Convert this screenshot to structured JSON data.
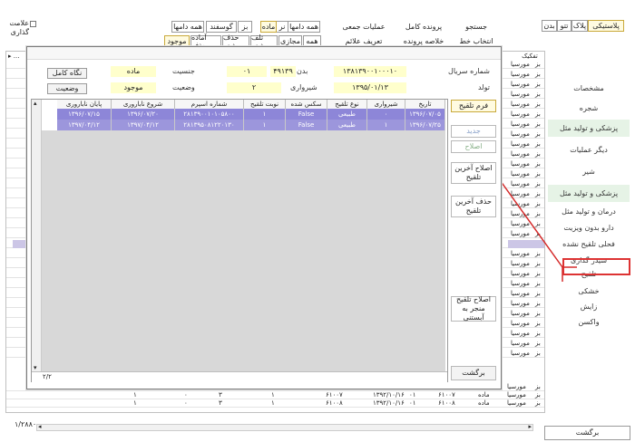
{
  "top_left": {
    "mark_label": "علامت گذاری",
    "status_count": "۱/۲۸۸۰"
  },
  "top_tabs_row1": {
    "all_herds": "همه دامها",
    "sheep": "گوسفند",
    "goat": "بز",
    "all_herds2": "همه دامها",
    "male": "نر",
    "female": "ماده",
    "group_ops": "عملیات جمعی",
    "full_file": "پرونده کامل",
    "search": "جستجو"
  },
  "top_tabs_row2": {
    "present": "موجود",
    "ready_for_slaughter": "آماده حذف",
    "removed": "حذف شده",
    "dead": "تلف شده",
    "virtual": "مجازی",
    "all": "همه",
    "mark_define": "تعریف علائم",
    "file_summary": "خلاصه پرونده",
    "line_select": "انتخاب خط"
  },
  "breed_tabs": {
    "plastic": "پلاستیکی",
    "pelak": "پلاک",
    "tattoo": "تتو",
    "badan": "بدن"
  },
  "bg_header_col": "تفکیک",
  "side_nav": [
    "مشخصات",
    "شجره",
    "پزشکی و تولید مثل",
    "دیگر عملیات",
    "شیر",
    "پزشکی و تولید مثل",
    "درمان و تولید مثل",
    "دارو بدون ویزیت",
    "فحلی تلقیح نشده",
    "سیدر گذاری",
    "تلقیح",
    "خشکی",
    "زایش",
    "واکسن"
  ],
  "bottom_back": "برگشت",
  "dialog": {
    "info": {
      "serial_label": "شماره سریال",
      "serial_value": "۱۳۸۱۳۹۰۰۱۰۰۰۱۰",
      "body_label": "بدن",
      "body_value": "۴۹۱۳۹",
      "herd_value": "۰۱",
      "sex_label": "جنسیت",
      "sex_value": "ماده",
      "birth_label": "تولد",
      "birth_value": "۱۳۹۵/۰۱/۱۳",
      "lactation_label": "شیرواری",
      "lactation_value": "۲",
      "status_label": "وضعیت",
      "status_value": "موجود",
      "full_view_btn": "نگاه کامل",
      "status_btn": "وضعیت"
    },
    "grid": {
      "columns": [
        "تاریخ",
        "شیرواری",
        "نوع تلقیح",
        "سکس شده",
        "نوبت تلقیح",
        "شماره اسپرم",
        "شروع ناباروری",
        "پایان ناباروری"
      ],
      "rows": [
        [
          "۱۳۹۶/۰۷/۰۵",
          "۰",
          "طبیعی",
          "False",
          "۱",
          "۲۸۱۳۹۰۰۱۰۱۰۵۸۰۰",
          "۱۳۹۶/۰۷/۲۰",
          "۱۳۹۶/۰۷/۱۵"
        ],
        [
          "۱۳۹۶/۰۷/۲۵",
          "۱",
          "طبیعی",
          "False",
          "۱",
          "۲۸۱۳۹۵۰۸۱۲۲۰۱۳۰",
          "۱۳۹۷/۰۴/۱۲",
          "۱۳۹۷/۰۴/۱۲"
        ]
      ],
      "footer": "۲/۲"
    },
    "side_buttons": {
      "insem_form": "فرم تلقیح",
      "new": "جدید",
      "edit": "اصلاح",
      "edit_last": "اصلاح آخرین تلقیح",
      "delete_last": "حذف آخرین تلقیح",
      "edit_abortion": "اصلاح تلقیح منجر به آبستنی",
      "back": "برگشت"
    }
  },
  "bg_rows": [
    {
      "herd": "بز",
      "type": "مورسیا"
    },
    {
      "herd": "بز",
      "type": "مورسیا"
    },
    {
      "herd": "بز",
      "type": "مورسیا"
    },
    {
      "herd": "بز",
      "type": "مورسیا"
    },
    {
      "herd": "بز",
      "type": "مورسیا"
    },
    {
      "herd": "بز",
      "type": "مورسیا"
    },
    {
      "herd": "بز",
      "type": "مورسیا"
    },
    {
      "herd": "بز",
      "type": "مورسیا"
    },
    {
      "herd": "بز",
      "type": "مورسیا"
    },
    {
      "herd": "بز",
      "type": "مورسیا"
    },
    {
      "herd": "بز",
      "type": "مورسیا"
    },
    {
      "herd": "بز",
      "type": "مورسیا"
    },
    {
      "herd": "بز",
      "type": "مورسیا"
    },
    {
      "herd": "بز",
      "type": "مورسیا"
    },
    {
      "herd": "بز",
      "type": "مورسیا"
    },
    {
      "herd": "بز",
      "type": "مورسیا"
    },
    {
      "herd": "بز",
      "type": "مورسیا"
    },
    {
      "herd": "بز",
      "type": "مورسیا"
    },
    {
      "herd": "بز",
      "type": "مورسیا"
    },
    {
      "herd": "بز",
      "type": "مورسیا"
    },
    {
      "herd": "بز",
      "type": "مورسیا"
    },
    {
      "herd": "بز",
      "type": "مورسیا"
    },
    {
      "herd": "بز",
      "type": "مورسیا"
    },
    {
      "herd": "بز",
      "type": "مورسیا"
    },
    {
      "herd": "بز",
      "type": "مورسیا"
    },
    {
      "herd": "بز",
      "type": "مورسیا"
    },
    {
      "herd": "بز",
      "type": "مورسیا"
    },
    {
      "herd": "بز",
      "type": "مورسیا"
    },
    {
      "herd": "بز",
      "type": "مورسیا"
    },
    {
      "herd": "بز",
      "type": "مورسیا"
    }
  ],
  "bottom_rows": [
    {
      "c1": "بز",
      "c2": "مورسیا",
      "c3": "ماده",
      "c4": "۶۱۰۰۲",
      "c5": "۰۱",
      "c6": "۱۳۹۲/۱۰/۱۶",
      "c7": "۶۱۰۰۲",
      "c8": "۱",
      "c9": "۲",
      "c10": "۰",
      "c11": "۱"
    },
    {
      "c1": "بز",
      "c2": "مورسیا",
      "c3": "ماده",
      "c4": "۶۱۰۰۷",
      "c5": "۰۱",
      "c6": "۱۳۹۲/۱۰/۱۶",
      "c7": "۶۱۰۰۷",
      "c8": "۱",
      "c9": "۳",
      "c10": "۰",
      "c11": "۱"
    },
    {
      "c1": "بز",
      "c2": "مورسیا",
      "c3": "ماده",
      "c4": "۶۱۰۰۸",
      "c5": "۰۱",
      "c6": "۱۳۹۲/۱۰/۱۶",
      "c7": "۶۱۰۰۸",
      "c8": "۱",
      "c9": "۳",
      "c10": "۰",
      "c11": "۱"
    }
  ]
}
